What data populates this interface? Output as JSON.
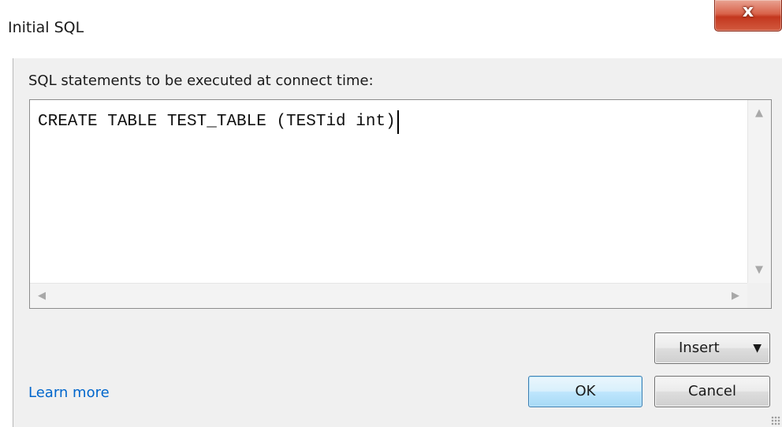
{
  "window": {
    "title": "Initial SQL",
    "close_glyph": "x"
  },
  "dialog": {
    "prompt_label": "SQL statements to be executed at connect time:",
    "sql_text": "CREATE TABLE TEST_TABLE (TESTid int)",
    "insert_label": "Insert",
    "insert_caret": "▼",
    "ok_label": "OK",
    "cancel_label": "Cancel",
    "learn_more_label": "Learn more"
  },
  "icons": {
    "close": "close-icon",
    "scroll_up": "▲",
    "scroll_down": "▼",
    "scroll_left": "◀",
    "scroll_right": "▶"
  },
  "colors": {
    "link": "#0066cc",
    "close_button": "#c3371e",
    "default_button": "#3c7fb1"
  }
}
